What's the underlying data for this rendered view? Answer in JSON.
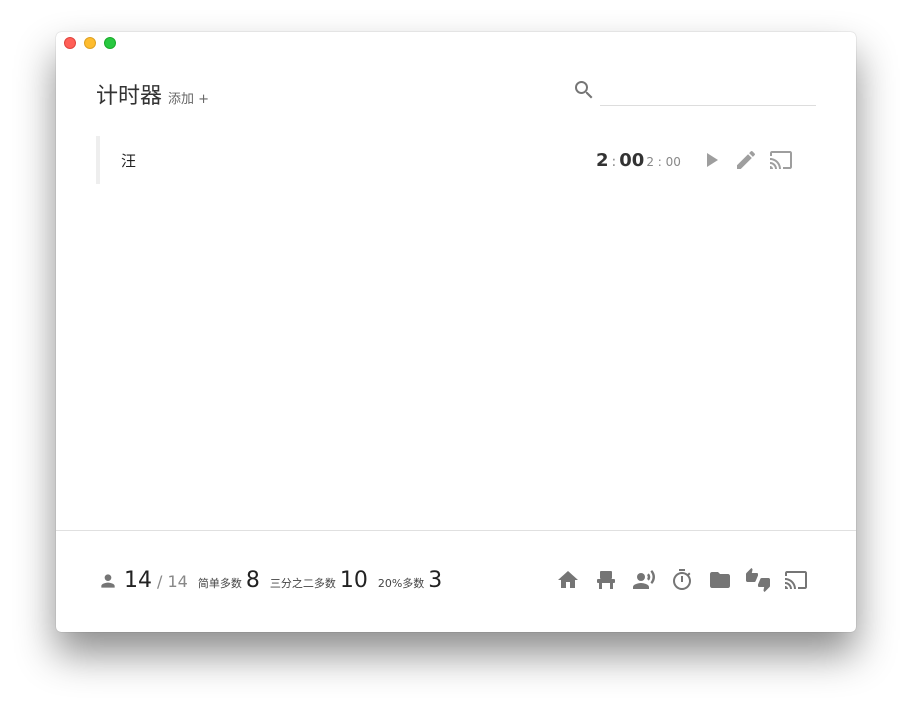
{
  "header": {
    "title": "计时器",
    "add_label": "添加 +"
  },
  "search": {
    "placeholder": "",
    "value": ""
  },
  "timers": [
    {
      "name": "汪",
      "minutes": "2",
      "seconds": "00",
      "total": "2 : 00"
    }
  ],
  "stats": {
    "present": "14",
    "total": "/ 14",
    "simple_majority_label": "简单多数",
    "simple_majority_value": "8",
    "two_thirds_label": "三分之二多数",
    "two_thirds_value": "10",
    "twenty_percent_label": "20%多数",
    "twenty_percent_value": "3"
  },
  "icons": {
    "search": "search-icon",
    "play": "play-icon",
    "edit": "pencil-icon",
    "cast": "cast-icon",
    "person": "person-icon",
    "footer": [
      "home-icon",
      "seat-icon",
      "speaker-icon",
      "timer-icon",
      "folder-icon",
      "thumbs-up-down-icon",
      "cast-icon"
    ]
  },
  "colors": {
    "icon": "#757575",
    "icon_muted": "#9e9e9e",
    "text": "#333333"
  }
}
